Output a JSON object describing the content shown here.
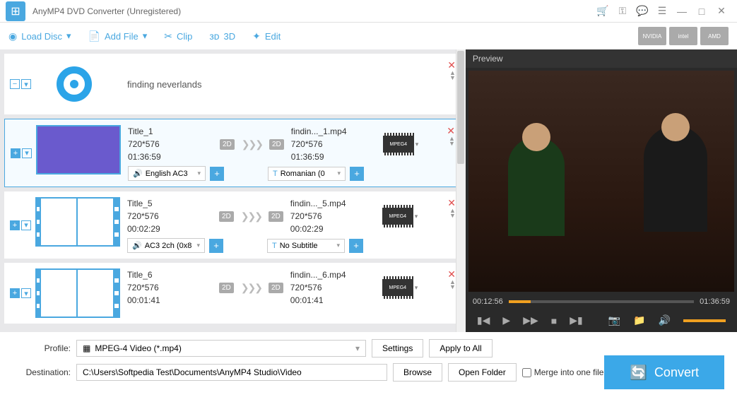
{
  "app": {
    "title": "AnyMP4 DVD Converter (Unregistered)"
  },
  "toolbar": {
    "load_disc": "Load Disc",
    "add_file": "Add File",
    "clip": "Clip",
    "three_d": "3D",
    "edit": "Edit"
  },
  "gpu": {
    "nvidia": "NVIDIA",
    "intel": "intel",
    "amd": "AMD"
  },
  "disc": {
    "title": "finding neverlands"
  },
  "tracks": [
    {
      "src_name": "Title_1",
      "src_res": "720*576",
      "src_dur": "01:36:59",
      "out_name": "findin..._1.mp4",
      "out_res": "720*576",
      "out_dur": "01:36:59",
      "badge_l": "2D",
      "badge_r": "2D",
      "audio": "English AC3",
      "subtitle": "Romanian (0",
      "fmt": "MPEG4",
      "selected": true,
      "thumb": "video"
    },
    {
      "src_name": "Title_5",
      "src_res": "720*576",
      "src_dur": "00:02:29",
      "out_name": "findin..._5.mp4",
      "out_res": "720*576",
      "out_dur": "00:02:29",
      "badge_l": "2D",
      "badge_r": "2D",
      "audio": "AC3 2ch (0x8",
      "subtitle": "No Subtitle",
      "fmt": "MPEG4",
      "selected": false,
      "thumb": "film"
    },
    {
      "src_name": "Title_6",
      "src_res": "720*576",
      "src_dur": "00:01:41",
      "out_name": "findin..._6.mp4",
      "out_res": "720*576",
      "out_dur": "00:01:41",
      "badge_l": "2D",
      "badge_r": "2D",
      "audio": "",
      "subtitle": "",
      "fmt": "MPEG4",
      "selected": false,
      "thumb": "film"
    }
  ],
  "preview": {
    "label": "Preview",
    "time_cur": "00:12:56",
    "time_total": "01:36:59"
  },
  "profile": {
    "label": "Profile:",
    "value": "MPEG-4 Video (*.mp4)",
    "settings": "Settings",
    "apply_all": "Apply to All"
  },
  "destination": {
    "label": "Destination:",
    "value": "C:\\Users\\Softpedia Test\\Documents\\AnyMP4 Studio\\Video",
    "browse": "Browse",
    "open": "Open Folder",
    "merge": "Merge into one file"
  },
  "convert": "Convert"
}
